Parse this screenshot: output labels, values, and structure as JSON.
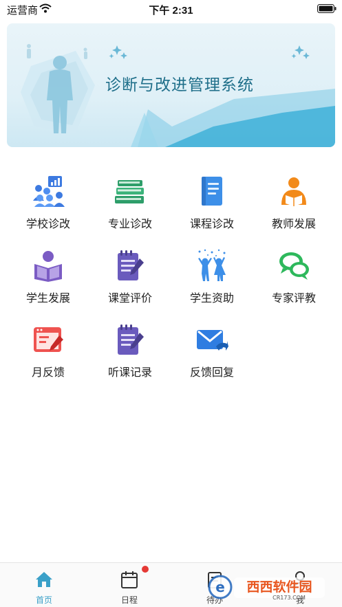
{
  "status_bar": {
    "carrier": "运营商",
    "time": "下午 2:31",
    "wifi_icon": "wifi-icon",
    "battery_icon": "battery-icon"
  },
  "banner": {
    "title": "诊断与改进管理系统"
  },
  "menu": {
    "items": [
      {
        "label": "学校诊改",
        "icon": "school-people-chart-icon"
      },
      {
        "label": "专业诊改",
        "icon": "book-stack-icon"
      },
      {
        "label": "课程诊改",
        "icon": "blue-book-icon"
      },
      {
        "label": "教师发展",
        "icon": "teacher-reading-icon"
      },
      {
        "label": "学生发展",
        "icon": "student-reading-icon"
      },
      {
        "label": "课堂评价",
        "icon": "notepad-pen-icon"
      },
      {
        "label": "学生资助",
        "icon": "cheering-kids-icon"
      },
      {
        "label": "专家评教",
        "icon": "chat-bubbles-icon"
      },
      {
        "label": "月反馈",
        "icon": "browser-edit-icon"
      },
      {
        "label": "听课记录",
        "icon": "notepad-pen-icon"
      },
      {
        "label": "反馈回复",
        "icon": "mail-reply-icon"
      }
    ]
  },
  "tab_bar": {
    "tabs": [
      {
        "label": "首页",
        "icon": "home-icon",
        "active": true
      },
      {
        "label": "日程",
        "icon": "calendar-icon",
        "badge": true
      },
      {
        "label": "待办",
        "icon": "todo-icon"
      },
      {
        "label": "我",
        "icon": "person-icon"
      }
    ]
  },
  "watermark": {
    "text": "西西软件园",
    "subtext": "CR173.COM"
  },
  "colors": {
    "accent": "#3aa0c8",
    "banner_title": "#1f6f8a",
    "badge": "#e53935"
  }
}
